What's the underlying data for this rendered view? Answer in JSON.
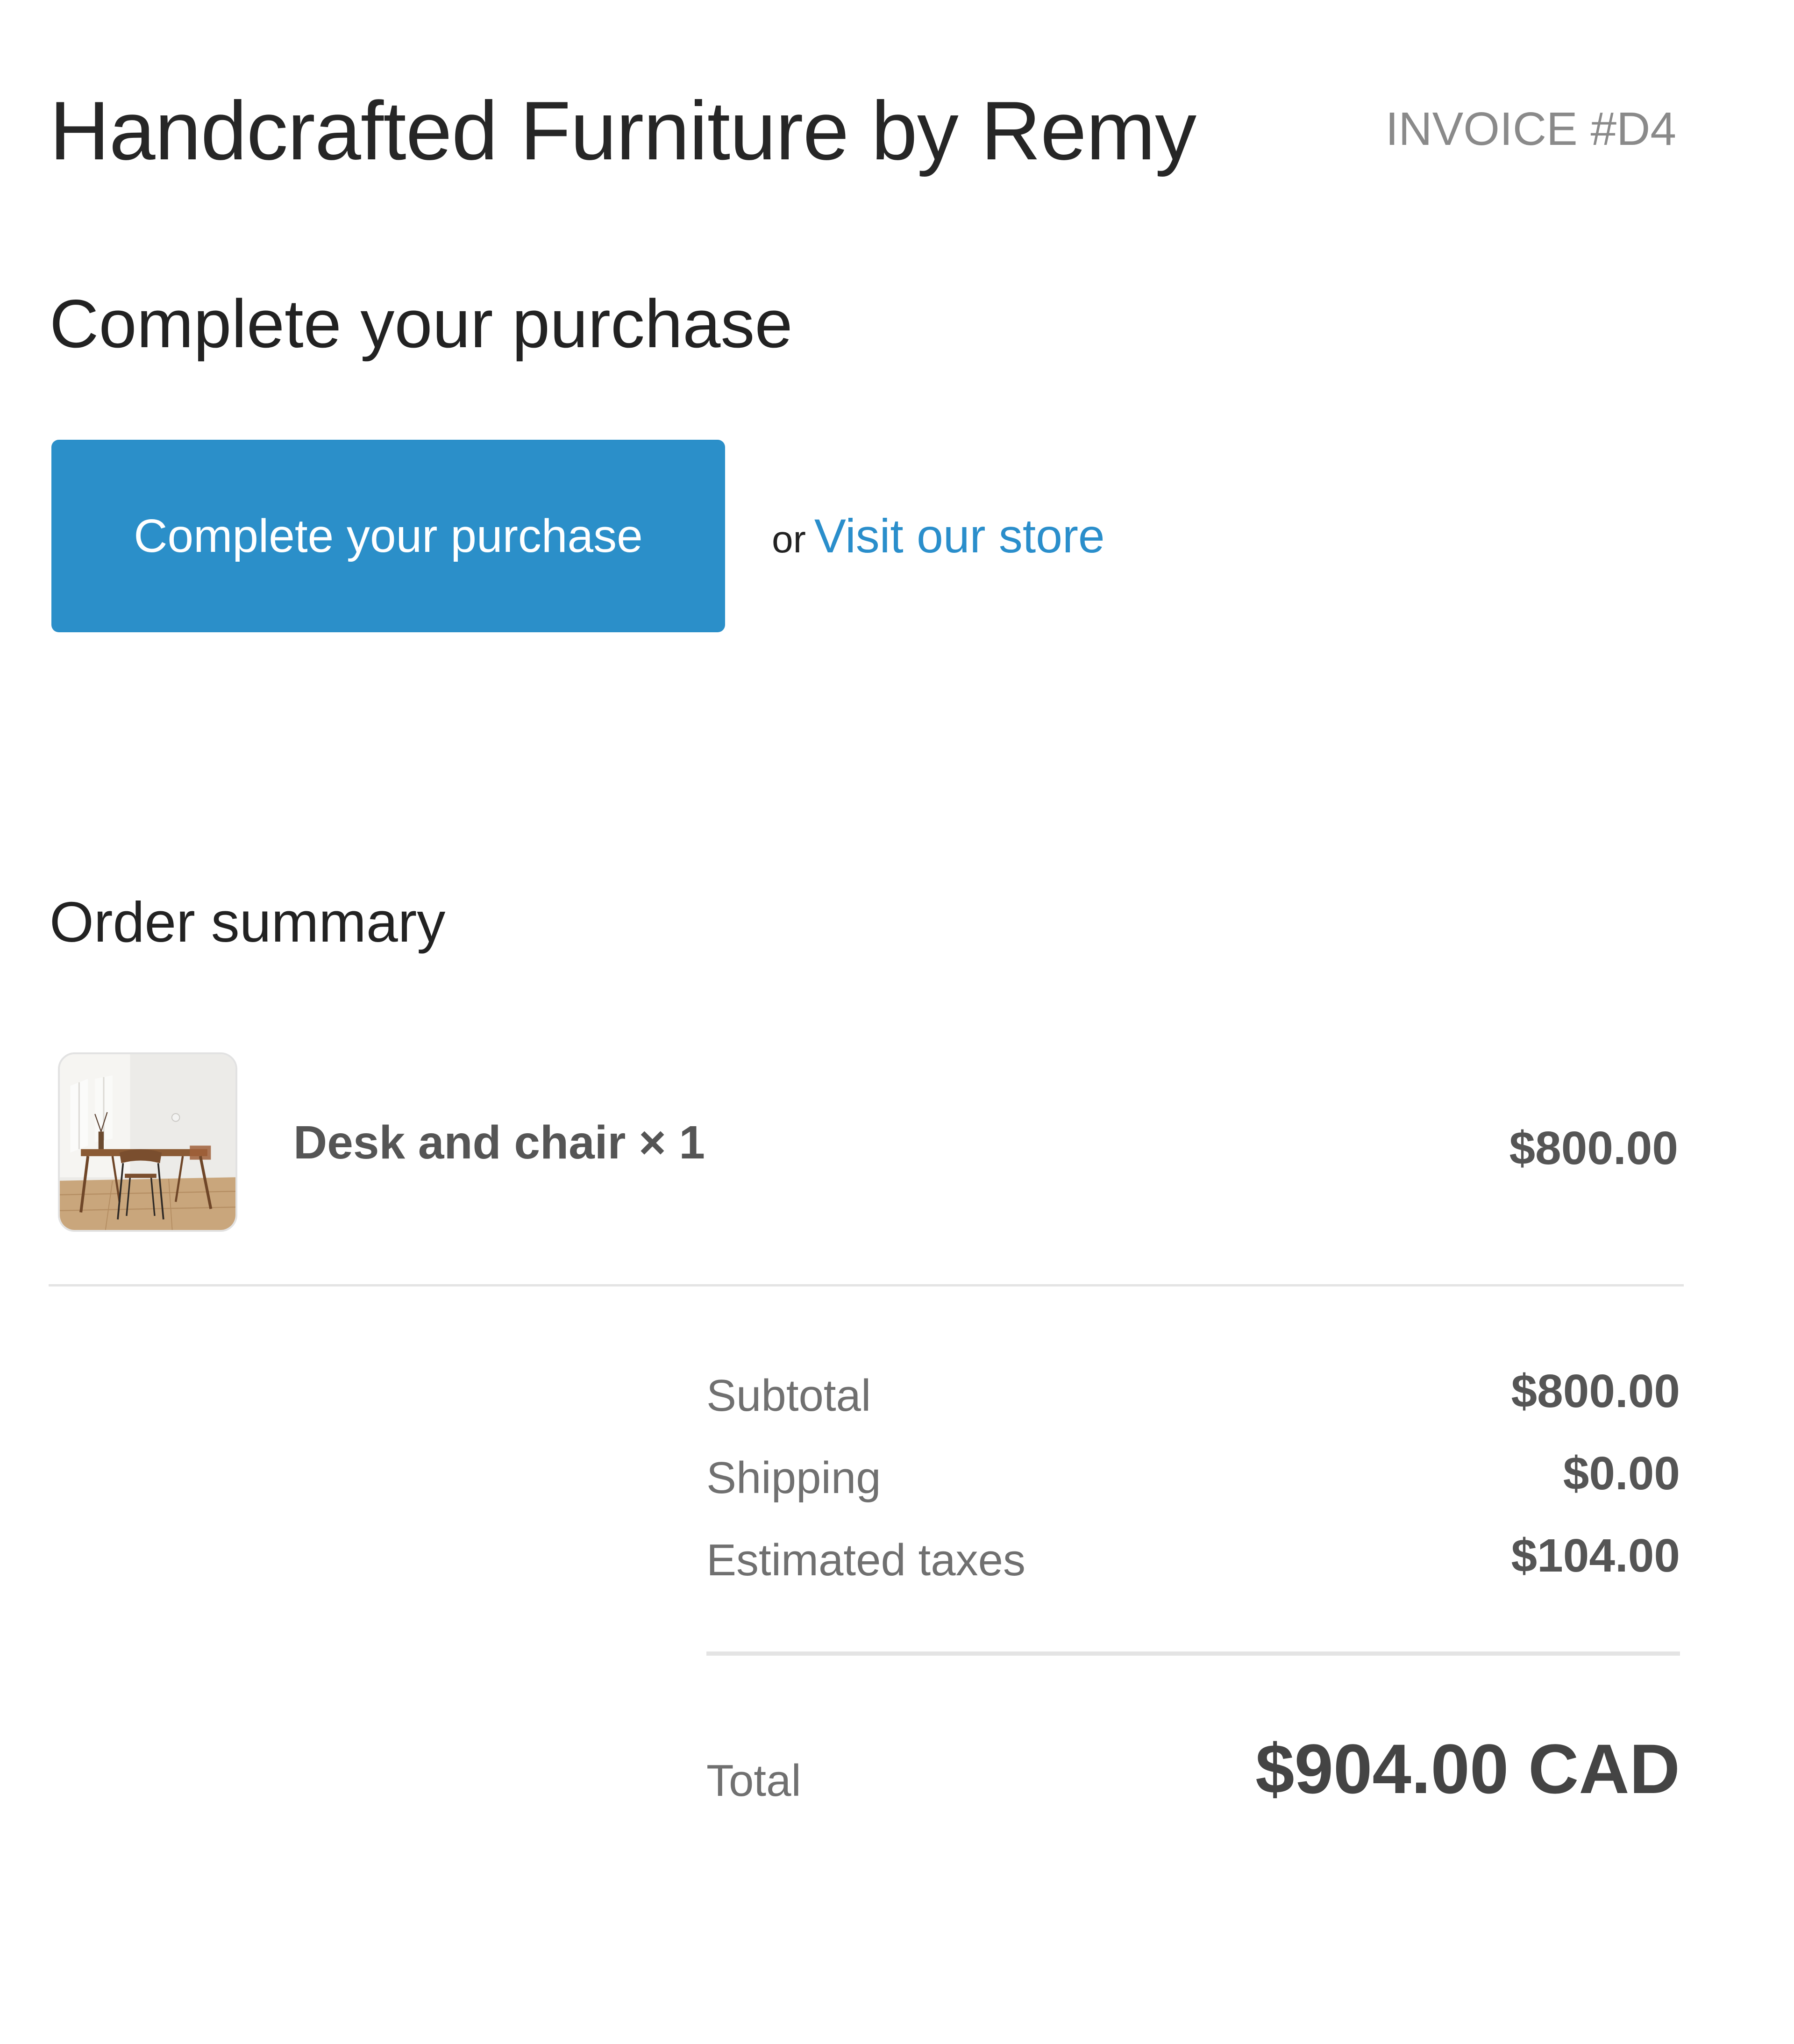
{
  "header": {
    "shop_name": "Handcrafted Furniture by Remy",
    "invoice_label": "INVOICE #D4"
  },
  "checkout": {
    "heading": "Complete your purchase",
    "button_label": "Complete your purchase",
    "or_text": "or",
    "store_link_label": "Visit our store"
  },
  "order_summary": {
    "heading": "Order summary",
    "line_items": [
      {
        "name": "Desk and chair × 1",
        "price": "$800.00",
        "image": "desk-and-chair-photo"
      }
    ],
    "totals": {
      "subtotal_label": "Subtotal",
      "subtotal_value": "$800.00",
      "shipping_label": "Shipping",
      "shipping_value": "$0.00",
      "taxes_label": "Estimated taxes",
      "taxes_value": "$104.00",
      "total_label": "Total",
      "total_value": "$904.00 CAD"
    }
  },
  "colors": {
    "button_bg": "#2b8fc9",
    "link": "#2a8ecb",
    "muted_text": "#8a8a8a",
    "divider": "#e4e4e4"
  }
}
